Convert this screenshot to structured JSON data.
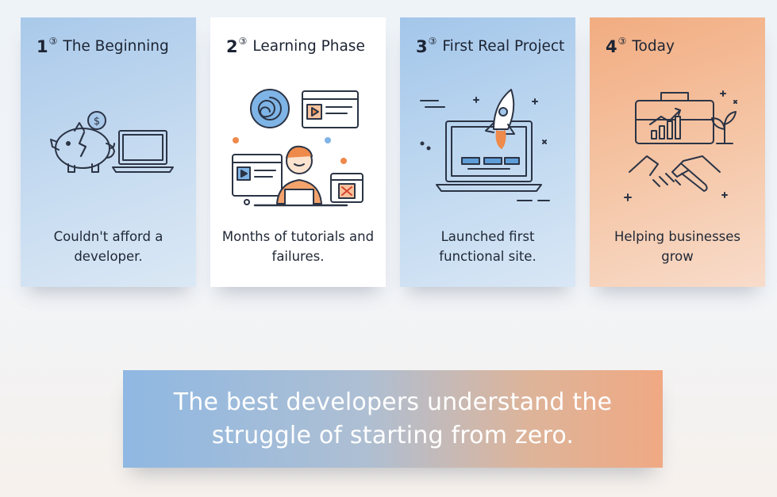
{
  "steps": [
    {
      "number": "1",
      "marker": "③",
      "title": "The Beginning",
      "description": "Couldn't afford a developer.",
      "icon": "piggy-bank-laptop-icon"
    },
    {
      "number": "2",
      "marker": "③",
      "title": "Learning Phase",
      "description": "Months of tutorials and failures.",
      "icon": "learner-with-tutorials-icon"
    },
    {
      "number": "3",
      "marker": "③",
      "title": "First Real Project",
      "description": "Launched first functional site.",
      "icon": "rocket-laptop-icon"
    },
    {
      "number": "4",
      "marker": "③",
      "title": "Today",
      "description": "Helping businesses grow",
      "icon": "briefcase-handshake-icon"
    }
  ],
  "quote": "The best developers understand the struggle of starting from zero.",
  "colors": {
    "blue_card": "#a9c9ea",
    "orange_card": "#f2ac80",
    "line_art": "#2b3445",
    "accent_orange": "#ee8a4c",
    "accent_blue": "#5e9ed8"
  }
}
